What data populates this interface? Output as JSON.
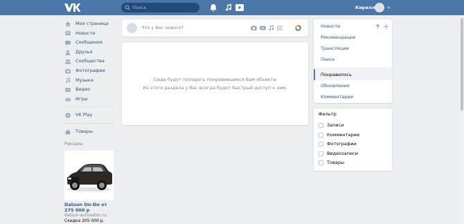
{
  "header": {
    "search_placeholder": "Поиск",
    "user_name": "Кирилл"
  },
  "sidebar": {
    "items": [
      {
        "label": "Моя страница",
        "icon": "home-icon"
      },
      {
        "label": "Новости",
        "icon": "news-icon"
      },
      {
        "label": "Сообщения",
        "icon": "messages-icon"
      },
      {
        "label": "Друзья",
        "icon": "friends-icon"
      },
      {
        "label": "Сообщества",
        "icon": "groups-icon"
      },
      {
        "label": "Фотографии",
        "icon": "photos-icon"
      },
      {
        "label": "Музыка",
        "icon": "music-icon"
      },
      {
        "label": "Видео",
        "icon": "video-icon"
      },
      {
        "label": "Игры",
        "icon": "games-icon"
      }
    ],
    "vkplay": "VK Play",
    "goods": "Товары",
    "ads_label": "Реклама",
    "ad": {
      "title": "Datsun On-Do от 275 000 р",
      "site": "datsun-autoaston.ru",
      "price": "Скидка 205 000 р."
    }
  },
  "composer": {
    "placeholder": "Что у Вас нового?"
  },
  "empty_state": {
    "line1": "Сюда будут попадать понравившиеся Вам объекты",
    "line2": "Из этого раздела у Вас всегда будет быстрый доступ к ним."
  },
  "right_menu": {
    "items": [
      "Новости",
      "Рекомендации",
      "Трансляции",
      "Поиск",
      "Понравилось",
      "Обновления",
      "Комментарии"
    ],
    "active": "Понравилось"
  },
  "filter": {
    "title": "Фильтр",
    "options": [
      "Записи",
      "Комментарии",
      "Фотографии",
      "Видеозаписи",
      "Товары"
    ]
  },
  "colors": {
    "header": "#4a76a8",
    "link": "#2a5885",
    "background": "#edeef0"
  }
}
